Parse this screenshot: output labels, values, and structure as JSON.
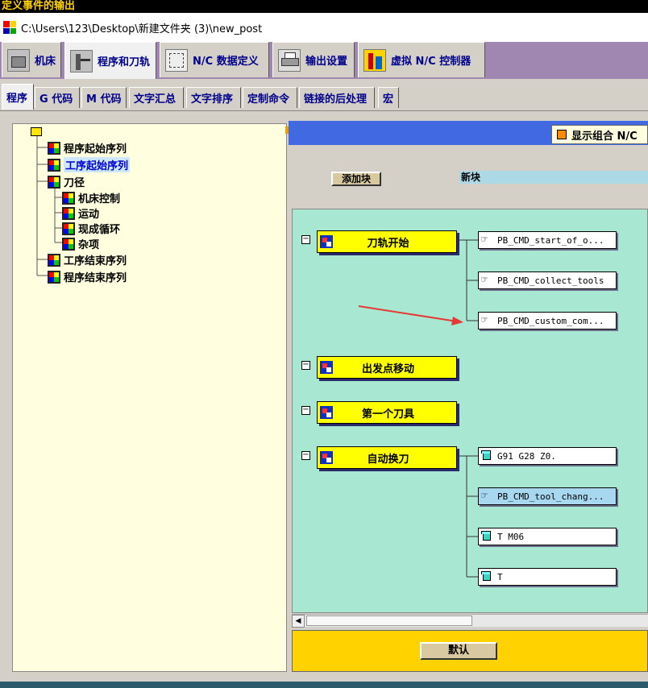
{
  "window": {
    "title": "定义事件的输出",
    "path": "C:\\Users\\123\\Desktop\\新建文件夹 (3)\\new_post"
  },
  "main_tabs": [
    {
      "label": "机床",
      "icon": "machine-tool-icon"
    },
    {
      "label": "程序和刀轨",
      "icon": "program-toolpath-icon"
    },
    {
      "label": "N/C 数据定义",
      "icon": "nc-data-icon"
    },
    {
      "label": "输出设置",
      "icon": "printer-icon"
    },
    {
      "label": "虚拟 N/C 控制器",
      "icon": "virtual-controller-icon"
    }
  ],
  "sub_tabs": [
    "程序",
    "G 代码",
    "M 代码",
    "文字汇总",
    "文字排序",
    "定制命令",
    "链接的后处理",
    "宏"
  ],
  "tree": {
    "items": [
      {
        "label": "程序起始序列"
      },
      {
        "label": "工序起始序列",
        "selected": true
      },
      {
        "label": "刀径"
      },
      {
        "label": "机床控制"
      },
      {
        "label": "运动"
      },
      {
        "label": "现成循环"
      },
      {
        "label": "杂项"
      },
      {
        "label": "工序结束序列"
      },
      {
        "label": "程序结束序列"
      }
    ]
  },
  "toolbar": {
    "show_combined": "显示组合 N/C",
    "add_block": "添加块",
    "new_block": "新块"
  },
  "events": [
    {
      "label": "刀轨开始",
      "blocks": [
        {
          "text": "PB_CMD_start_of_o...",
          "kind": "command"
        },
        {
          "text": "PB_CMD_collect_tools",
          "kind": "command"
        },
        {
          "text": "PB_CMD_custom_com...",
          "kind": "command"
        }
      ]
    },
    {
      "label": "出发点移动",
      "blocks": []
    },
    {
      "label": "第一个刀具",
      "blocks": []
    },
    {
      "label": "自动换刀",
      "blocks": [
        {
          "text": "G91 G28 Z0.",
          "kind": "block"
        },
        {
          "text": "PB_CMD_tool_chang...",
          "kind": "command",
          "selected": true
        },
        {
          "text": "T M06",
          "kind": "block"
        },
        {
          "text": "T",
          "kind": "block"
        }
      ]
    }
  ],
  "footer": {
    "default_button": "默认"
  },
  "colors": {
    "title_text": "#ffd200",
    "tab_strip": "#9f87b1",
    "tree_bg": "#ffffe0",
    "canvas_bg": "#a8e8d2",
    "event_bg": "#ffff00",
    "header_bar": "#4169e1",
    "annotation_arrow": "#e53935"
  }
}
